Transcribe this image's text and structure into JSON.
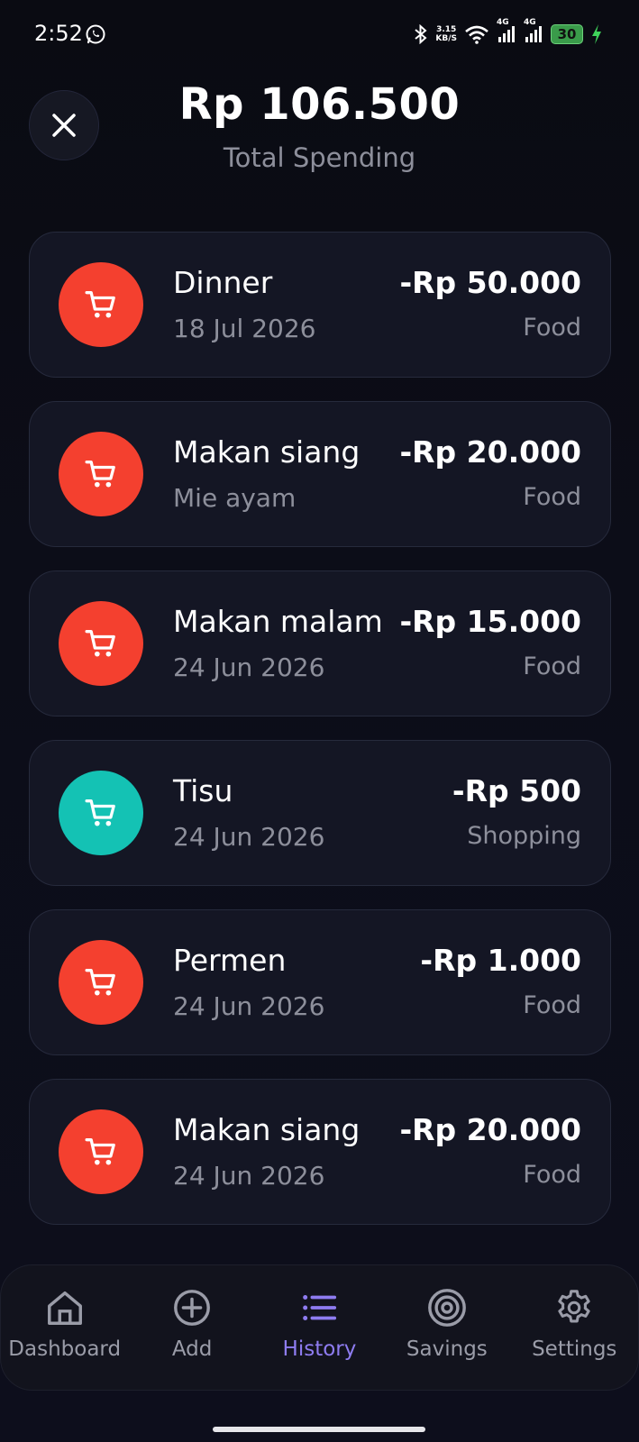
{
  "status_bar": {
    "time": "2:52",
    "net_speed_value": "3.15",
    "net_speed_unit": "KB/S",
    "network_1": "4G",
    "network_2": "4G",
    "battery": "30"
  },
  "header": {
    "total_amount": "Rp 106.500",
    "total_label": "Total Spending"
  },
  "transactions": [
    {
      "title": "Dinner",
      "subtitle": "18  Jul 2026",
      "amount": "-Rp 50.000",
      "category": "Food",
      "icon": "shopping-cart-icon",
      "color": "#f4402f"
    },
    {
      "title": "Makan siang",
      "subtitle": "Mie ayam",
      "amount": "-Rp 20.000",
      "category": "Food",
      "icon": "shopping-cart-icon",
      "color": "#f4402f"
    },
    {
      "title": "Makan malam",
      "subtitle": "24  Jun 2026",
      "amount": "-Rp 15.000",
      "category": "Food",
      "icon": "shopping-cart-icon",
      "color": "#f4402f"
    },
    {
      "title": "Tisu",
      "subtitle": "24  Jun 2026",
      "amount": "-Rp 500",
      "category": "Shopping",
      "icon": "shopping-cart-icon",
      "color": "#14c2b4"
    },
    {
      "title": "Permen",
      "subtitle": "24  Jun 2026",
      "amount": "-Rp 1.000",
      "category": "Food",
      "icon": "shopping-cart-icon",
      "color": "#f4402f"
    },
    {
      "title": "Makan siang",
      "subtitle": "24  Jun 2026",
      "amount": "-Rp 20.000",
      "category": "Food",
      "icon": "shopping-cart-icon",
      "color": "#f4402f"
    }
  ],
  "nav": {
    "items": [
      {
        "label": "Dashboard",
        "icon": "home-icon"
      },
      {
        "label": "Add",
        "icon": "plus-circle-icon"
      },
      {
        "label": "History",
        "icon": "list-icon",
        "active": true
      },
      {
        "label": "Savings",
        "icon": "target-icon"
      },
      {
        "label": "Settings",
        "icon": "gear-icon"
      }
    ],
    "active_color": "#8e7cf0"
  }
}
